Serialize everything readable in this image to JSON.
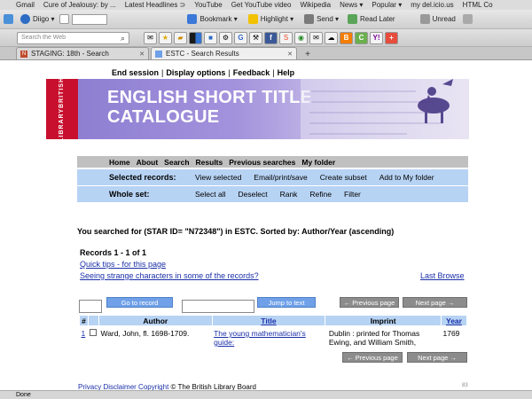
{
  "bookmarks": [
    "Gmail",
    "Cure of Jealousy: by ...",
    "Latest Headlines ⊃",
    "YouTube",
    "Get YouTube video",
    "Wikipedia",
    "News ▾",
    "Popular ▾",
    "my del.icio.us",
    "HTML Co"
  ],
  "toolbar": {
    "user": "Diigo ▾",
    "bookmark": "Bookmark ▾",
    "highlight": "Highlight ▾",
    "send": "Send ▾",
    "read_later": "Read Later",
    "unread": "Unread"
  },
  "search": {
    "placeholder": "Search the Web"
  },
  "tabs": [
    {
      "label": "STAGING: 18th - Search",
      "active": false
    },
    {
      "label": "ESTC - Search Results",
      "active": true
    }
  ],
  "topnav": [
    "End session",
    "Display options",
    "Feedback",
    "Help"
  ],
  "banner": {
    "line1": "ENGLISH SHORT TITLE",
    "line2": "CATALOGUE",
    "logo_top": "BRITISH",
    "logo_bottom": "LIBRARY"
  },
  "menu": {
    "row1": [
      "Home",
      "About",
      "Search",
      "Results",
      "Previous searches",
      "My folder"
    ],
    "selected_label": "Selected records:",
    "selected_items": [
      "View selected",
      "Email/print/save",
      "Create subset",
      "Add to My folder"
    ],
    "whole_label": "Whole set:",
    "whole_items": [
      "Select all",
      "Deselect",
      "Rank",
      "Refine",
      "Filter"
    ]
  },
  "searched_text": "You searched for (STAR ID= \"N72348\") in ESTC. Sorted by: Author/Year (ascending)",
  "records_count": "Records 1 - 1 of 1",
  "quick_tips": "Quick tips - for this page",
  "strange_chars": "Seeing strange characters in some of the records?",
  "last_browse": "Last Browse",
  "buttons": {
    "go_to_record": "Go to record",
    "jump_to_text": "Jump to text",
    "previous_page": "← Previous page",
    "next_page": "Next page →"
  },
  "table": {
    "headers": [
      "#",
      "",
      "Author",
      "Title",
      "Imprint",
      "Year"
    ],
    "rows": [
      {
        "num": "1",
        "author": "Ward, John, fl. 1698-1709.",
        "title": "The young mathematician's guide:",
        "imprint": "Dublin : printed for Thomas Ewing, and William Smith,",
        "year": "1769"
      }
    ]
  },
  "footer": {
    "privacy": "Privacy",
    "disclaimer": "Disclaimer",
    "copyright": "Copyright",
    "rest": "© The British Library Board",
    "num": "83"
  },
  "status": "Done"
}
